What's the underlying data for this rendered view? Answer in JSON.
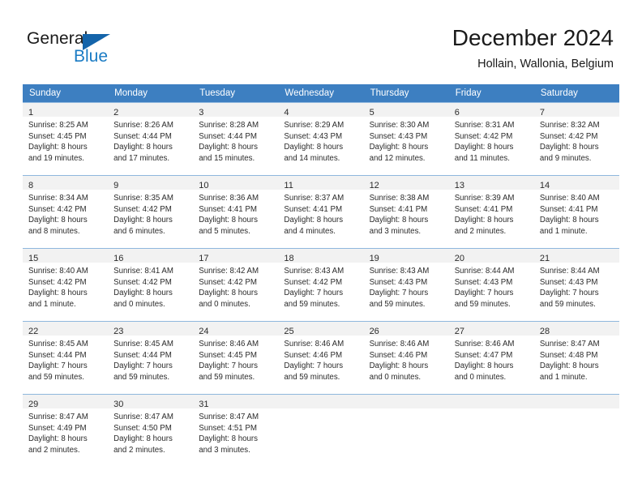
{
  "brand": {
    "name_part1": "General",
    "name_part2": "Blue",
    "accent_color": "#1a7bc4",
    "triangle_color": "#1464aa"
  },
  "header": {
    "title": "December 2024",
    "subtitle": "Hollain, Wallonia, Belgium"
  },
  "calendar": {
    "header_color": "#3d7fc1",
    "weekday_headers": [
      "Sunday",
      "Monday",
      "Tuesday",
      "Wednesday",
      "Thursday",
      "Friday",
      "Saturday"
    ],
    "weeks": [
      [
        {
          "day": "1",
          "sunrise": "Sunrise: 8:25 AM",
          "sunset": "Sunset: 4:45 PM",
          "daylight1": "Daylight: 8 hours",
          "daylight2": "and 19 minutes."
        },
        {
          "day": "2",
          "sunrise": "Sunrise: 8:26 AM",
          "sunset": "Sunset: 4:44 PM",
          "daylight1": "Daylight: 8 hours",
          "daylight2": "and 17 minutes."
        },
        {
          "day": "3",
          "sunrise": "Sunrise: 8:28 AM",
          "sunset": "Sunset: 4:44 PM",
          "daylight1": "Daylight: 8 hours",
          "daylight2": "and 15 minutes."
        },
        {
          "day": "4",
          "sunrise": "Sunrise: 8:29 AM",
          "sunset": "Sunset: 4:43 PM",
          "daylight1": "Daylight: 8 hours",
          "daylight2": "and 14 minutes."
        },
        {
          "day": "5",
          "sunrise": "Sunrise: 8:30 AM",
          "sunset": "Sunset: 4:43 PM",
          "daylight1": "Daylight: 8 hours",
          "daylight2": "and 12 minutes."
        },
        {
          "day": "6",
          "sunrise": "Sunrise: 8:31 AM",
          "sunset": "Sunset: 4:42 PM",
          "daylight1": "Daylight: 8 hours",
          "daylight2": "and 11 minutes."
        },
        {
          "day": "7",
          "sunrise": "Sunrise: 8:32 AM",
          "sunset": "Sunset: 4:42 PM",
          "daylight1": "Daylight: 8 hours",
          "daylight2": "and 9 minutes."
        }
      ],
      [
        {
          "day": "8",
          "sunrise": "Sunrise: 8:34 AM",
          "sunset": "Sunset: 4:42 PM",
          "daylight1": "Daylight: 8 hours",
          "daylight2": "and 8 minutes."
        },
        {
          "day": "9",
          "sunrise": "Sunrise: 8:35 AM",
          "sunset": "Sunset: 4:42 PM",
          "daylight1": "Daylight: 8 hours",
          "daylight2": "and 6 minutes."
        },
        {
          "day": "10",
          "sunrise": "Sunrise: 8:36 AM",
          "sunset": "Sunset: 4:41 PM",
          "daylight1": "Daylight: 8 hours",
          "daylight2": "and 5 minutes."
        },
        {
          "day": "11",
          "sunrise": "Sunrise: 8:37 AM",
          "sunset": "Sunset: 4:41 PM",
          "daylight1": "Daylight: 8 hours",
          "daylight2": "and 4 minutes."
        },
        {
          "day": "12",
          "sunrise": "Sunrise: 8:38 AM",
          "sunset": "Sunset: 4:41 PM",
          "daylight1": "Daylight: 8 hours",
          "daylight2": "and 3 minutes."
        },
        {
          "day": "13",
          "sunrise": "Sunrise: 8:39 AM",
          "sunset": "Sunset: 4:41 PM",
          "daylight1": "Daylight: 8 hours",
          "daylight2": "and 2 minutes."
        },
        {
          "day": "14",
          "sunrise": "Sunrise: 8:40 AM",
          "sunset": "Sunset: 4:41 PM",
          "daylight1": "Daylight: 8 hours",
          "daylight2": "and 1 minute."
        }
      ],
      [
        {
          "day": "15",
          "sunrise": "Sunrise: 8:40 AM",
          "sunset": "Sunset: 4:42 PM",
          "daylight1": "Daylight: 8 hours",
          "daylight2": "and 1 minute."
        },
        {
          "day": "16",
          "sunrise": "Sunrise: 8:41 AM",
          "sunset": "Sunset: 4:42 PM",
          "daylight1": "Daylight: 8 hours",
          "daylight2": "and 0 minutes."
        },
        {
          "day": "17",
          "sunrise": "Sunrise: 8:42 AM",
          "sunset": "Sunset: 4:42 PM",
          "daylight1": "Daylight: 8 hours",
          "daylight2": "and 0 minutes."
        },
        {
          "day": "18",
          "sunrise": "Sunrise: 8:43 AM",
          "sunset": "Sunset: 4:42 PM",
          "daylight1": "Daylight: 7 hours",
          "daylight2": "and 59 minutes."
        },
        {
          "day": "19",
          "sunrise": "Sunrise: 8:43 AM",
          "sunset": "Sunset: 4:43 PM",
          "daylight1": "Daylight: 7 hours",
          "daylight2": "and 59 minutes."
        },
        {
          "day": "20",
          "sunrise": "Sunrise: 8:44 AM",
          "sunset": "Sunset: 4:43 PM",
          "daylight1": "Daylight: 7 hours",
          "daylight2": "and 59 minutes."
        },
        {
          "day": "21",
          "sunrise": "Sunrise: 8:44 AM",
          "sunset": "Sunset: 4:43 PM",
          "daylight1": "Daylight: 7 hours",
          "daylight2": "and 59 minutes."
        }
      ],
      [
        {
          "day": "22",
          "sunrise": "Sunrise: 8:45 AM",
          "sunset": "Sunset: 4:44 PM",
          "daylight1": "Daylight: 7 hours",
          "daylight2": "and 59 minutes."
        },
        {
          "day": "23",
          "sunrise": "Sunrise: 8:45 AM",
          "sunset": "Sunset: 4:44 PM",
          "daylight1": "Daylight: 7 hours",
          "daylight2": "and 59 minutes."
        },
        {
          "day": "24",
          "sunrise": "Sunrise: 8:46 AM",
          "sunset": "Sunset: 4:45 PM",
          "daylight1": "Daylight: 7 hours",
          "daylight2": "and 59 minutes."
        },
        {
          "day": "25",
          "sunrise": "Sunrise: 8:46 AM",
          "sunset": "Sunset: 4:46 PM",
          "daylight1": "Daylight: 7 hours",
          "daylight2": "and 59 minutes."
        },
        {
          "day": "26",
          "sunrise": "Sunrise: 8:46 AM",
          "sunset": "Sunset: 4:46 PM",
          "daylight1": "Daylight: 8 hours",
          "daylight2": "and 0 minutes."
        },
        {
          "day": "27",
          "sunrise": "Sunrise: 8:46 AM",
          "sunset": "Sunset: 4:47 PM",
          "daylight1": "Daylight: 8 hours",
          "daylight2": "and 0 minutes."
        },
        {
          "day": "28",
          "sunrise": "Sunrise: 8:47 AM",
          "sunset": "Sunset: 4:48 PM",
          "daylight1": "Daylight: 8 hours",
          "daylight2": "and 1 minute."
        }
      ],
      [
        {
          "day": "29",
          "sunrise": "Sunrise: 8:47 AM",
          "sunset": "Sunset: 4:49 PM",
          "daylight1": "Daylight: 8 hours",
          "daylight2": "and 2 minutes."
        },
        {
          "day": "30",
          "sunrise": "Sunrise: 8:47 AM",
          "sunset": "Sunset: 4:50 PM",
          "daylight1": "Daylight: 8 hours",
          "daylight2": "and 2 minutes."
        },
        {
          "day": "31",
          "sunrise": "Sunrise: 8:47 AM",
          "sunset": "Sunset: 4:51 PM",
          "daylight1": "Daylight: 8 hours",
          "daylight2": "and 3 minutes."
        },
        {
          "day": "",
          "sunrise": "",
          "sunset": "",
          "daylight1": "",
          "daylight2": ""
        },
        {
          "day": "",
          "sunrise": "",
          "sunset": "",
          "daylight1": "",
          "daylight2": ""
        },
        {
          "day": "",
          "sunrise": "",
          "sunset": "",
          "daylight1": "",
          "daylight2": ""
        },
        {
          "day": "",
          "sunrise": "",
          "sunset": "",
          "daylight1": "",
          "daylight2": ""
        }
      ]
    ]
  }
}
